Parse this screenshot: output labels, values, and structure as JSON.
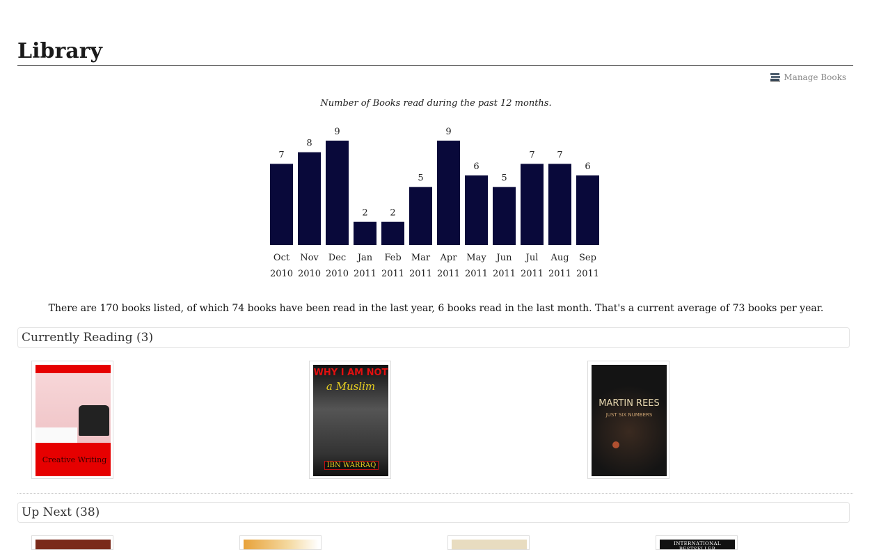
{
  "page": {
    "title": "Library"
  },
  "toolbar": {
    "manage_label": "Manage Books",
    "manage_icon": "books-icon"
  },
  "chart_data": {
    "type": "bar",
    "title": "Number of Books read during the past 12 months.",
    "categories": [
      [
        "Oct",
        "2010"
      ],
      [
        "Nov",
        "2010"
      ],
      [
        "Dec",
        "2010"
      ],
      [
        "Jan",
        "2011"
      ],
      [
        "Feb",
        "2011"
      ],
      [
        "Mar",
        "2011"
      ],
      [
        "Apr",
        "2011"
      ],
      [
        "May",
        "2011"
      ],
      [
        "Jun",
        "2011"
      ],
      [
        "Jul",
        "2011"
      ],
      [
        "Aug",
        "2011"
      ],
      [
        "Sep",
        "2011"
      ]
    ],
    "values": [
      7,
      8,
      9,
      2,
      2,
      5,
      9,
      6,
      5,
      7,
      7,
      6
    ],
    "ylim": [
      0,
      9
    ],
    "bar_color": "#09093a",
    "grid": false,
    "data_labels": true
  },
  "summary": "There are 170 books listed, of which 74 books have been read in the last year, 6 books read in the last month. That's a current average of 73 books per year.",
  "sections": {
    "currently_reading": {
      "label": "Currently Reading (3)",
      "books": [
        {
          "title_line1": "",
          "title_line2": "Creative Writing",
          "cover_color": "#e60000"
        },
        {
          "title_line1": "WHY I AM NOT",
          "title_line2": "a Muslim",
          "author": "IBN WARRAQ",
          "cover_color": "#2a2a2a"
        },
        {
          "title_line1": "MARTIN REES",
          "title_line2": "JUST SIX NUMBERS",
          "cover_color": "#1a1a1a"
        }
      ]
    },
    "up_next": {
      "label": "Up Next (38)",
      "books": [
        {
          "cover_color": "#7a2a1a"
        },
        {
          "cover_color": "#e8a23a"
        },
        {
          "cover_color": "#e8dcc0"
        },
        {
          "title_line1": "INTERNATIONAL BESTSELLER",
          "cover_color": "#111111"
        }
      ]
    }
  }
}
